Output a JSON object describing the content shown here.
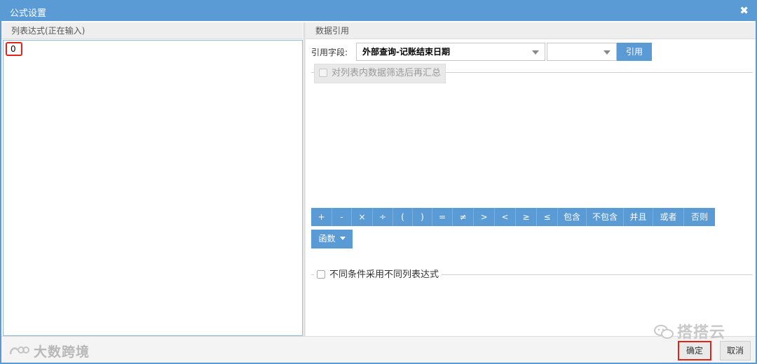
{
  "dialog": {
    "title": "公式设置",
    "close_icon": "close-icon",
    "close_glyph": "✖"
  },
  "left_panel": {
    "header": "列表达式(正在输入)",
    "expression_value": "0"
  },
  "right_panel": {
    "header": "数据引用",
    "field_label": "引用字段:",
    "field_select_value": "外部查询-记账结束日期",
    "sub_select_value": "",
    "ref_button": "引用",
    "filter_checkbox_label": "对列表内数据筛选后再汇总",
    "operators": [
      "+",
      "-",
      "×",
      "÷",
      "(",
      ")",
      "=",
      "≠",
      ">",
      "<",
      "≥",
      "≤",
      "包含",
      "不包含",
      "并且",
      "或者",
      "否则"
    ],
    "function_button": "函数",
    "condition_checkbox_label": "不同条件采用不同列表达式"
  },
  "footer": {
    "ok_button": "确定",
    "cancel_button": "取消"
  },
  "watermarks": {
    "left": "大数跨境",
    "right": "搭搭云"
  },
  "colors": {
    "accent": "#5b9bd5",
    "highlight": "#e2231a"
  }
}
